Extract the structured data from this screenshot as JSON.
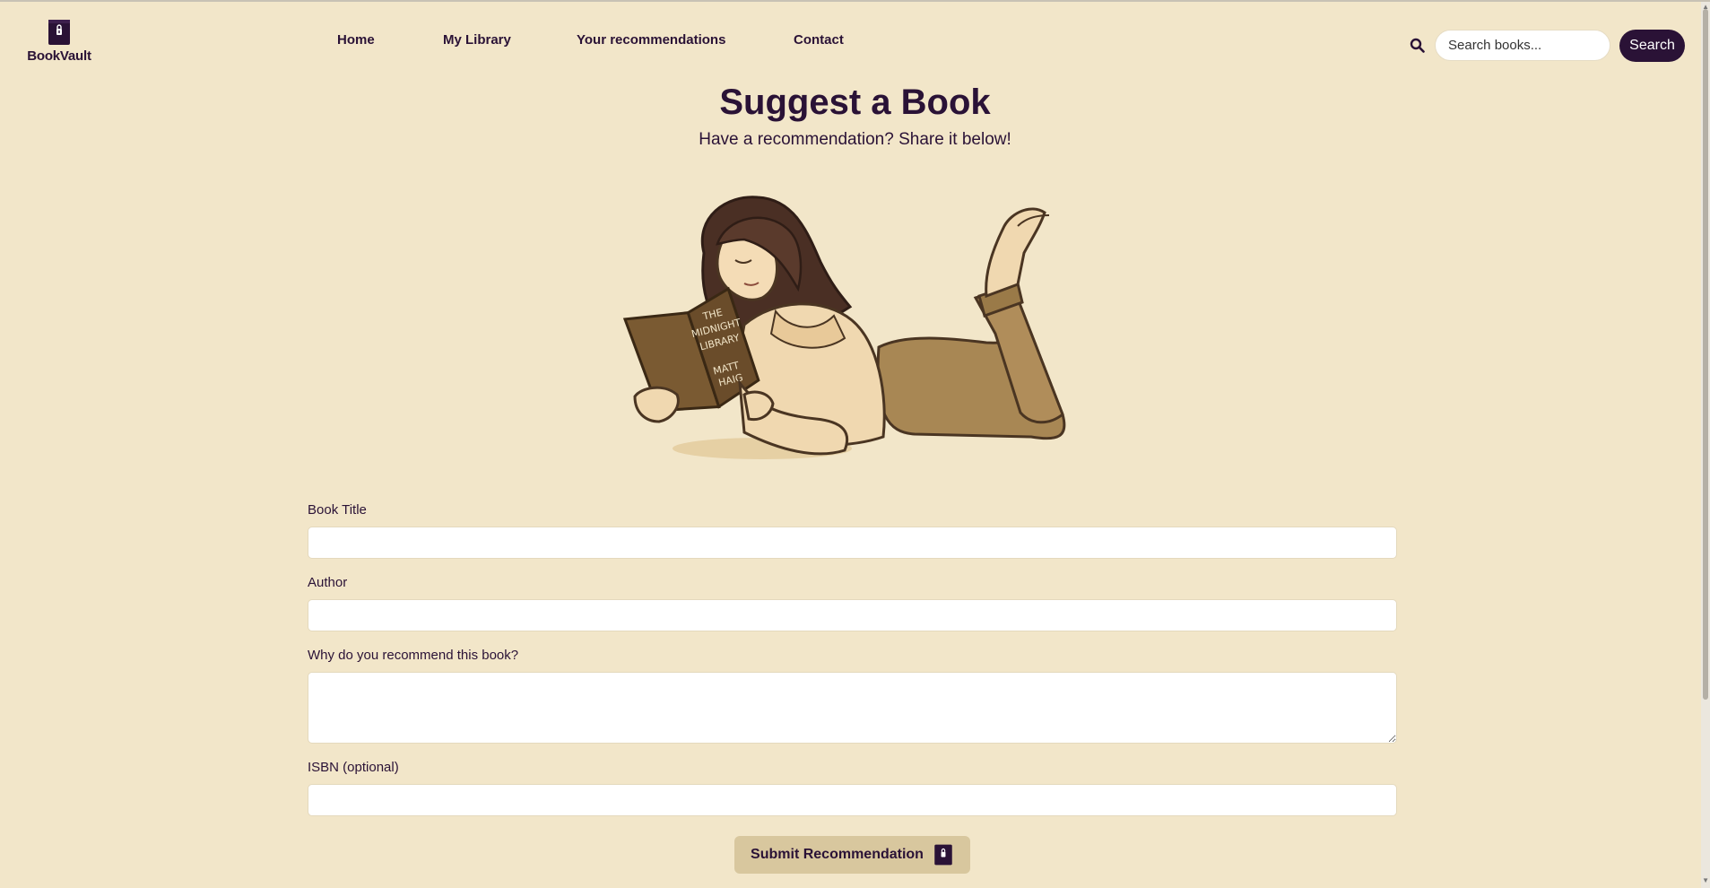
{
  "brand": {
    "name": "BookVault",
    "icon": "book-lock-icon"
  },
  "nav": [
    {
      "label": "Home"
    },
    {
      "label": "My Library"
    },
    {
      "label": "Your recommendations"
    },
    {
      "label": "Contact"
    }
  ],
  "search": {
    "icon": "search-icon",
    "placeholder": "Search books...",
    "value": "",
    "button_label": "Search"
  },
  "page": {
    "title": "Suggest a Book",
    "subtitle": "Have a recommendation? Share it below!"
  },
  "illustration": {
    "book_cover_lines": [
      "THE",
      "MIDNIGHT",
      "LIBRARY",
      "MATT",
      "HAIG"
    ]
  },
  "form": {
    "fields": [
      {
        "label": "Book Title",
        "value": ""
      },
      {
        "label": "Author",
        "value": ""
      },
      {
        "label": "Why do you recommend this book?",
        "value": ""
      },
      {
        "label": "ISBN (optional)",
        "value": ""
      }
    ],
    "submit_label": "Submit Recommendation",
    "submit_icon": "book-lock-icon"
  },
  "colors": {
    "background": "#f2e6c9",
    "primary": "#2a1236",
    "button_beige": "#d8c79e"
  }
}
